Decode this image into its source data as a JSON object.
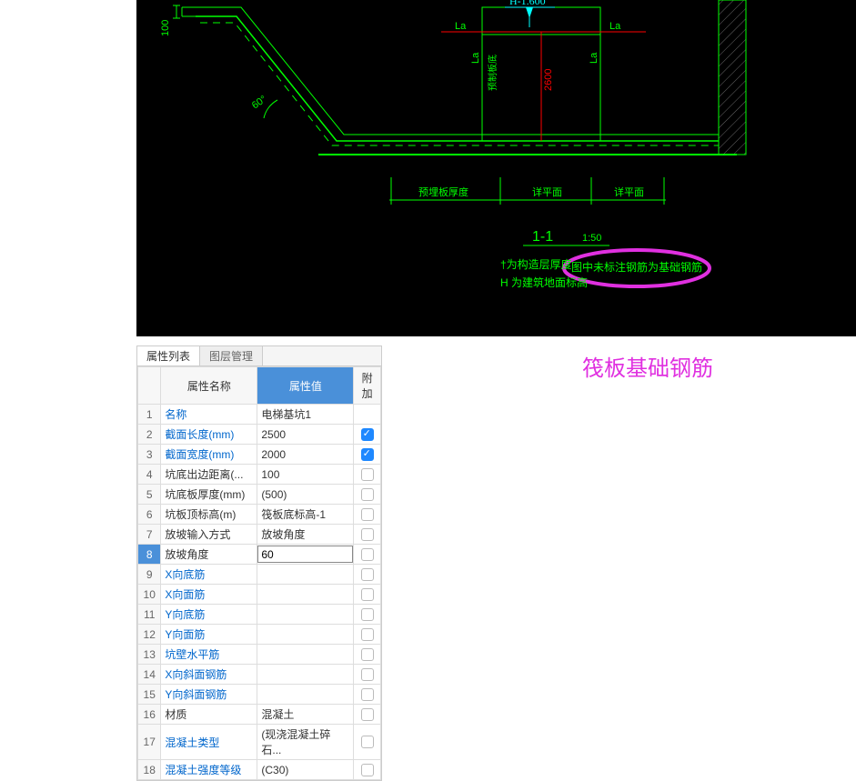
{
  "cad": {
    "dim_100": "100",
    "angle_60": "60°",
    "h_value": "H-1.600",
    "la": "La",
    "dim_2600": "2600",
    "note_left": "预制板底",
    "lbl_bottom1": "预埋板厚度",
    "lbl_bottom2": "详平面",
    "lbl_bottom3": "详平面",
    "section": "1-1",
    "scale": "1:50",
    "note1": "†为构造层厚度",
    "note2": "图中未标注钢筋为基础钢筋",
    "note3": "H 为建筑地面标高"
  },
  "annotation": "筏板基础钢筋",
  "tabs": {
    "props": "属性列表",
    "layers": "图层管理"
  },
  "headers": {
    "name": "属性名称",
    "value": "属性值",
    "add": "附加"
  },
  "rows": [
    {
      "n": "1",
      "name": "名称",
      "val": "电梯基坑1",
      "link": true,
      "chk": null
    },
    {
      "n": "2",
      "name": "截面长度(mm)",
      "val": "2500",
      "link": true,
      "chk": true
    },
    {
      "n": "3",
      "name": "截面宽度(mm)",
      "val": "2000",
      "link": true,
      "chk": true
    },
    {
      "n": "4",
      "name": "坑底出边距离(...",
      "val": "100",
      "link": false,
      "chk": false
    },
    {
      "n": "5",
      "name": "坑底板厚度(mm)",
      "val": "(500)",
      "link": false,
      "chk": false
    },
    {
      "n": "6",
      "name": "坑板顶标高(m)",
      "val": "筏板底标高-1",
      "link": false,
      "chk": false
    },
    {
      "n": "7",
      "name": "放坡输入方式",
      "val": "放坡角度",
      "link": false,
      "chk": false
    },
    {
      "n": "8",
      "name": "放坡角度",
      "val": "60",
      "link": false,
      "chk": false,
      "sel": true,
      "edit": true
    },
    {
      "n": "9",
      "name": "X向底筋",
      "val": "",
      "link": true,
      "chk": false
    },
    {
      "n": "10",
      "name": "X向面筋",
      "val": "",
      "link": true,
      "chk": false
    },
    {
      "n": "11",
      "name": "Y向底筋",
      "val": "",
      "link": true,
      "chk": false
    },
    {
      "n": "12",
      "name": "Y向面筋",
      "val": "",
      "link": true,
      "chk": false
    },
    {
      "n": "13",
      "name": "坑壁水平筋",
      "val": "",
      "link": true,
      "chk": false
    },
    {
      "n": "14",
      "name": "X向斜面钢筋",
      "val": "",
      "link": true,
      "chk": false
    },
    {
      "n": "15",
      "name": "Y向斜面钢筋",
      "val": "",
      "link": true,
      "chk": false
    },
    {
      "n": "16",
      "name": "材质",
      "val": "混凝土",
      "link": false,
      "chk": false
    },
    {
      "n": "17",
      "name": "混凝土类型",
      "val": "(现浇混凝土碎石...",
      "link": true,
      "chk": false
    },
    {
      "n": "18",
      "name": "混凝土强度等级",
      "val": "(C30)",
      "link": true,
      "chk": false
    }
  ]
}
